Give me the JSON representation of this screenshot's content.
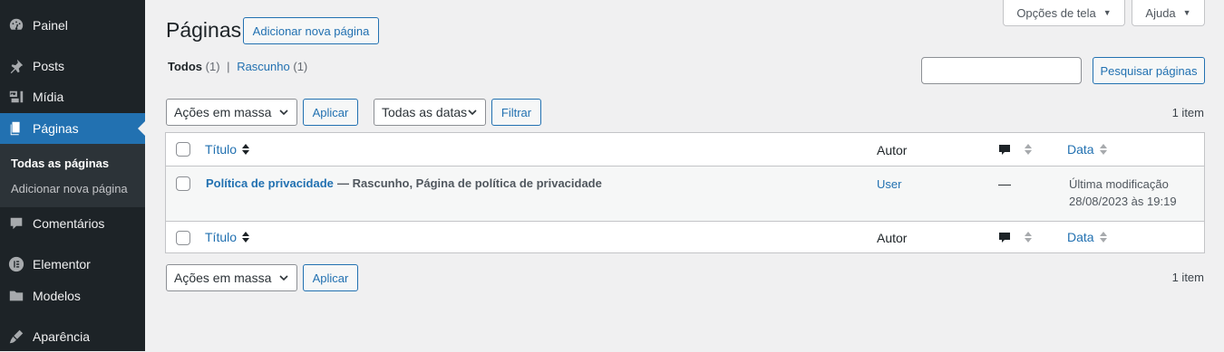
{
  "sidebar": {
    "items": [
      {
        "label": "Painel",
        "icon": "dashboard-icon"
      },
      {
        "label": "Posts",
        "icon": "pin-icon"
      },
      {
        "label": "Mídia",
        "icon": "media-icon"
      },
      {
        "label": "Páginas",
        "icon": "pages-icon"
      },
      {
        "label": "Comentários",
        "icon": "comment-icon"
      },
      {
        "label": "Elementor",
        "icon": "elementor-icon"
      },
      {
        "label": "Modelos",
        "icon": "folder-icon"
      },
      {
        "label": "Aparência",
        "icon": "brush-icon"
      }
    ],
    "submenu": [
      "Todas as páginas",
      "Adicionar nova página"
    ]
  },
  "header": {
    "title": "Páginas",
    "add_new": "Adicionar nova página",
    "screen_options": "Opções de tela",
    "help": "Ajuda"
  },
  "views": {
    "all_label": "Todos",
    "all_count": "(1)",
    "separator": "|",
    "draft_label": "Rascunho",
    "draft_count": "(1)"
  },
  "search": {
    "button": "Pesquisar páginas",
    "value": ""
  },
  "filters": {
    "bulk_actions": "Ações em massa",
    "apply": "Aplicar",
    "dates": "Todas as datas",
    "filter": "Filtrar",
    "items_count": "1 item"
  },
  "table": {
    "columns": {
      "title": "Título",
      "author": "Autor",
      "date": "Data"
    },
    "rows": [
      {
        "title": "Política de privacidade",
        "state": "— Rascunho, Página de política de privacidade",
        "author": "User",
        "comments": "—",
        "date_label": "Última modificação",
        "date_value": "28/08/2023 às 19:19"
      }
    ]
  },
  "colors": {
    "sidebar_bg": "#1d2327",
    "accent": "#2271b1",
    "page_bg": "#f0f0f1"
  }
}
